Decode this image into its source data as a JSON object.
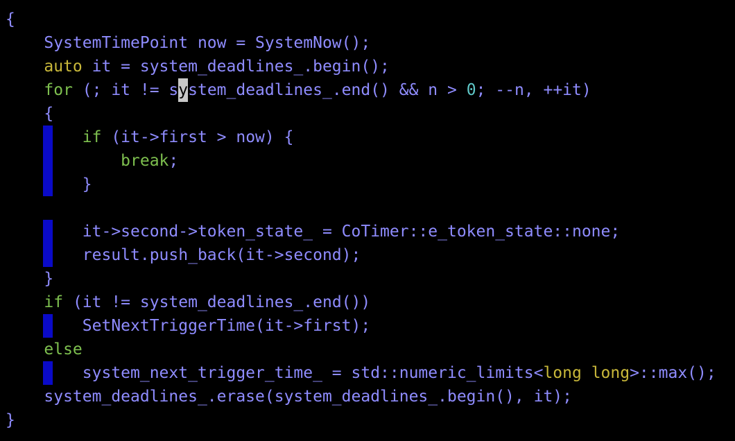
{
  "colors": {
    "background": "#000000",
    "default": "#8f8cff",
    "keyword": "#7ec04f",
    "type": "#c9b83a",
    "number": "#5fc8c8",
    "indent_guide": "#0a0ac8",
    "cursor": "#c8c8c8"
  },
  "indent_guides": [
    {
      "from_line": 5,
      "to_line": 7
    },
    {
      "from_line": 9,
      "to_line": 10
    },
    {
      "from_line": 13,
      "to_line": 13
    },
    {
      "from_line": 15,
      "to_line": 15
    }
  ],
  "lines": [
    [
      {
        "t": "{",
        "c": "default"
      }
    ],
    [
      {
        "t": "    SystemTimePoint now = SystemNow();",
        "c": "default"
      }
    ],
    [
      {
        "t": "    ",
        "c": "default"
      },
      {
        "t": "auto",
        "c": "type"
      },
      {
        "t": " it = system_deadlines_.begin();",
        "c": "default"
      }
    ],
    [
      {
        "t": "    ",
        "c": "default"
      },
      {
        "t": "for",
        "c": "keyword"
      },
      {
        "t": " (; it != s",
        "c": "default"
      },
      {
        "t": "y",
        "c": "cursor"
      },
      {
        "t": "stem_deadlines_.end() && n > ",
        "c": "default"
      },
      {
        "t": "0",
        "c": "number"
      },
      {
        "t": "; --n, ++it)",
        "c": "default"
      }
    ],
    [
      {
        "t": "    {",
        "c": "default"
      }
    ],
    [
      {
        "t": "        ",
        "c": "default"
      },
      {
        "t": "if",
        "c": "keyword"
      },
      {
        "t": " (it->first > now) {",
        "c": "default"
      }
    ],
    [
      {
        "t": "            ",
        "c": "default"
      },
      {
        "t": "break",
        "c": "keyword"
      },
      {
        "t": ";",
        "c": "default"
      }
    ],
    [
      {
        "t": "        }",
        "c": "default"
      }
    ],
    [],
    [
      {
        "t": "        it->second->token_state_ = CoTimer::e_token_state::none;",
        "c": "default"
      }
    ],
    [
      {
        "t": "        result.push_back(it->second);",
        "c": "default"
      }
    ],
    [
      {
        "t": "    }",
        "c": "default"
      }
    ],
    [
      {
        "t": "    ",
        "c": "default"
      },
      {
        "t": "if",
        "c": "keyword"
      },
      {
        "t": " (it != system_deadlines_.end())",
        "c": "default"
      }
    ],
    [
      {
        "t": "        SetNextTriggerTime(it->first);",
        "c": "default"
      }
    ],
    [
      {
        "t": "    ",
        "c": "default"
      },
      {
        "t": "else",
        "c": "keyword"
      }
    ],
    [
      {
        "t": "        system_next_trigger_time_ = std::numeric_limits<",
        "c": "default"
      },
      {
        "t": "long long",
        "c": "type"
      },
      {
        "t": ">::max();",
        "c": "default"
      }
    ],
    [
      {
        "t": "    system_deadlines_.erase(system_deadlines_.begin(), it);",
        "c": "default"
      }
    ],
    [
      {
        "t": "}",
        "c": "default"
      }
    ]
  ]
}
